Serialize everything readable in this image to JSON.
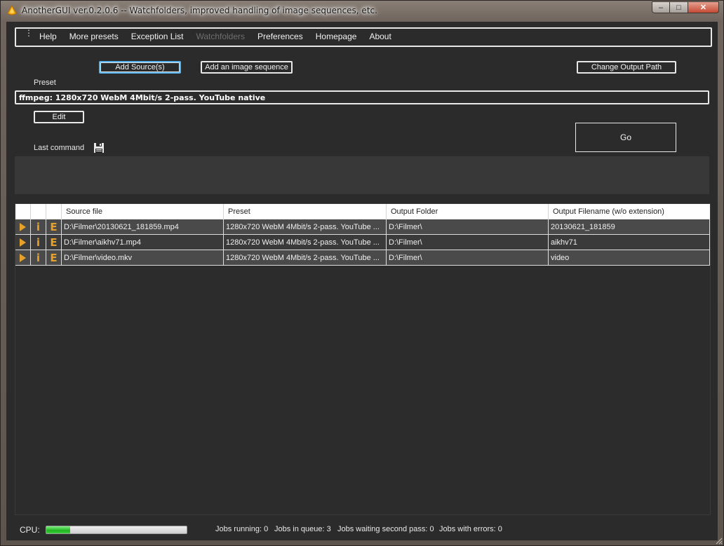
{
  "window": {
    "title": "AnotherGUI ver.0.2.0.6 -- Watchfolders, improved handling of image sequences, etc.",
    "controls": {
      "minimize": "–",
      "maximize": "□",
      "close": "✕"
    }
  },
  "menu": {
    "items": [
      {
        "label": "Help",
        "enabled": true
      },
      {
        "label": "More presets",
        "enabled": true
      },
      {
        "label": "Exception List",
        "enabled": true
      },
      {
        "label": "Watchfolders",
        "enabled": false
      },
      {
        "label": "Preferences",
        "enabled": true
      },
      {
        "label": "Homepage",
        "enabled": true
      },
      {
        "label": "About",
        "enabled": true
      }
    ]
  },
  "toolbar": {
    "add_source": "Add Source(s)",
    "add_sequence": "Add an image sequence",
    "change_output": "Change Output Path",
    "edit": "Edit",
    "go": "Go"
  },
  "preset": {
    "label": "Preset",
    "value": "ffmpeg: 1280x720  WebM 4Mbit/s 2-pass. YouTube native"
  },
  "last_command": {
    "label": "Last command",
    "icon": "save-icon"
  },
  "grid": {
    "columns": [
      "",
      "",
      "",
      "Source file",
      "Preset",
      "Output Folder",
      "Output Filename (w/o extension)"
    ],
    "rows": [
      {
        "source": "D:\\Filmer\\20130621_181859.mp4",
        "preset": "1280x720  WebM 4Mbit/s 2-pass. YouTube ...",
        "folder": "D:\\Filmer\\",
        "filename": "20130621_181859"
      },
      {
        "source": "D:\\Filmer\\aikhv71.mp4",
        "preset": "1280x720  WebM 4Mbit/s 2-pass. YouTube ...",
        "folder": "D:\\Filmer\\",
        "filename": "aikhv71"
      },
      {
        "source": "D:\\Filmer\\video.mkv",
        "preset": "1280x720  WebM 4Mbit/s 2-pass. YouTube ...",
        "folder": "D:\\Filmer\\",
        "filename": "video"
      }
    ],
    "row_icons": {
      "play": "play-icon",
      "info": "i",
      "edit": "E"
    }
  },
  "status": {
    "cpu_label": "CPU:",
    "cpu_usage_fraction": 0.17,
    "jobs_running": "Jobs running: 0",
    "jobs_in_queue": "Jobs in queue: 3",
    "jobs_waiting": "Jobs waiting second pass: 0",
    "jobs_errors": "Jobs with errors: 0"
  },
  "colors": {
    "background": "#2b2b2b",
    "accent": "#e7a12a",
    "focus": "#56b4f0",
    "progress": "#1fb41f"
  }
}
